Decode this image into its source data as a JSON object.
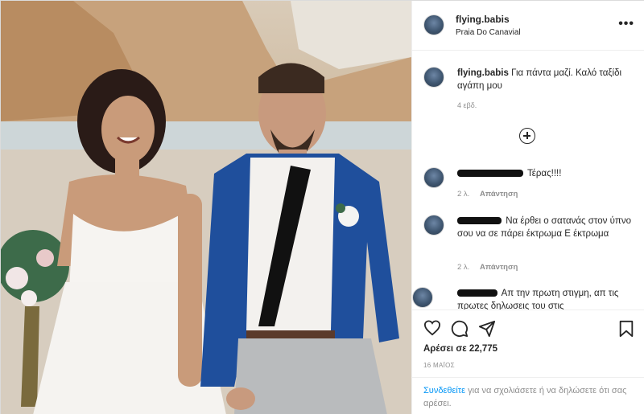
{
  "post": {
    "username": "flying.babis",
    "location": "Praia Do Canavial",
    "more_icon": "ellipsis-icon"
  },
  "caption": {
    "username": "flying.babis",
    "text": "Για πάντα μαζί. Καλό ταξίδι αγάπη μου",
    "time": "4 εβδ."
  },
  "load_more_icon": "plus-circle-icon",
  "comments": [
    {
      "text": "Τέρας!!!!",
      "time": "2 λ.",
      "reply": "Απάντηση"
    },
    {
      "text": "Να έρθει ο σατανάς στον ύπνο σου να σε πάρει έκτρωμα Ε έκτρωμα",
      "time": "2 λ.",
      "reply": "Απάντηση"
    },
    {
      "text": "Απ την πρωτη στιγμη, απ τις πρωτες δηλωσεις του στις"
    }
  ],
  "actions": {
    "icons": [
      "heart-icon",
      "comment-icon",
      "share-icon",
      "bookmark-icon"
    ],
    "likes": "Αρέσει σε 22,775",
    "date": "16 ΜΑΪΟΣ"
  },
  "login_prompt": {
    "link": "Συνδεθείτε",
    "text": " για να σχολιάσετε ή να δηλώσετε ότι σας αρέσει."
  },
  "colors": {
    "link": "#0095f6",
    "secondary_text": "#8e8e8e",
    "border": "#efefef",
    "jacket": "#1f4f9c"
  }
}
